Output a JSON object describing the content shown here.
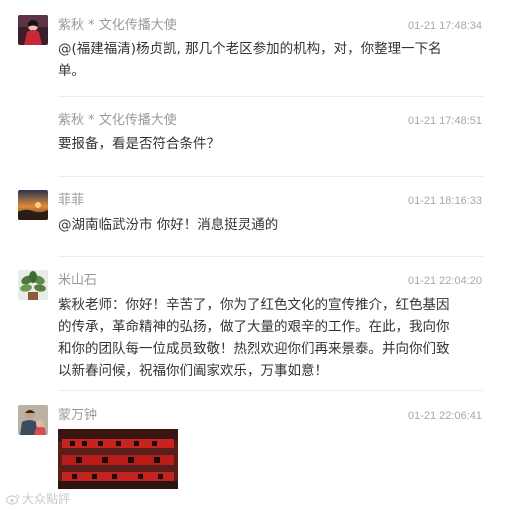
{
  "posts": [
    {
      "author": "紫秋 * 文化传播大使",
      "time": "01-21 17:48:34",
      "content": "@(福建福清)杨贞凯, 那几个老区参加的机构，对，你整理一下名单。",
      "avatar_icon": "avatar-red-figure"
    },
    {
      "author": "紫秋 * 文化传播大使",
      "time": "01-21 17:48:51",
      "content": "要报备，看是否符合条件？"
    },
    {
      "author": "菲菲",
      "time": "01-21 18:16:33",
      "content": "@湖南临武汾市 你好！消息挺灵通的",
      "avatar_icon": "avatar-sunset-landscape"
    },
    {
      "author": "米山石",
      "time": "01-21 22:04:20",
      "content": "紫秋老师：你好！辛苦了，你为了红色文化的宣传推介，红色基因的传承，革命精神的弘扬，做了大量的艰辛的工作。在此，我向你和你的团队每一位成员致敬！热烈欢迎你们再来景泰。并向你们致以新春问候，祝福你们阖家欢乐，万事如意！",
      "avatar_icon": "avatar-green-plant"
    },
    {
      "author": "蒙万钟",
      "time": "01-21 22:06:41",
      "avatar_icon": "avatar-person-child",
      "attachment_icon": "photo-red-couplets"
    }
  ],
  "watermark": {
    "text": "大众點評",
    "icon": "weibo-icon"
  }
}
